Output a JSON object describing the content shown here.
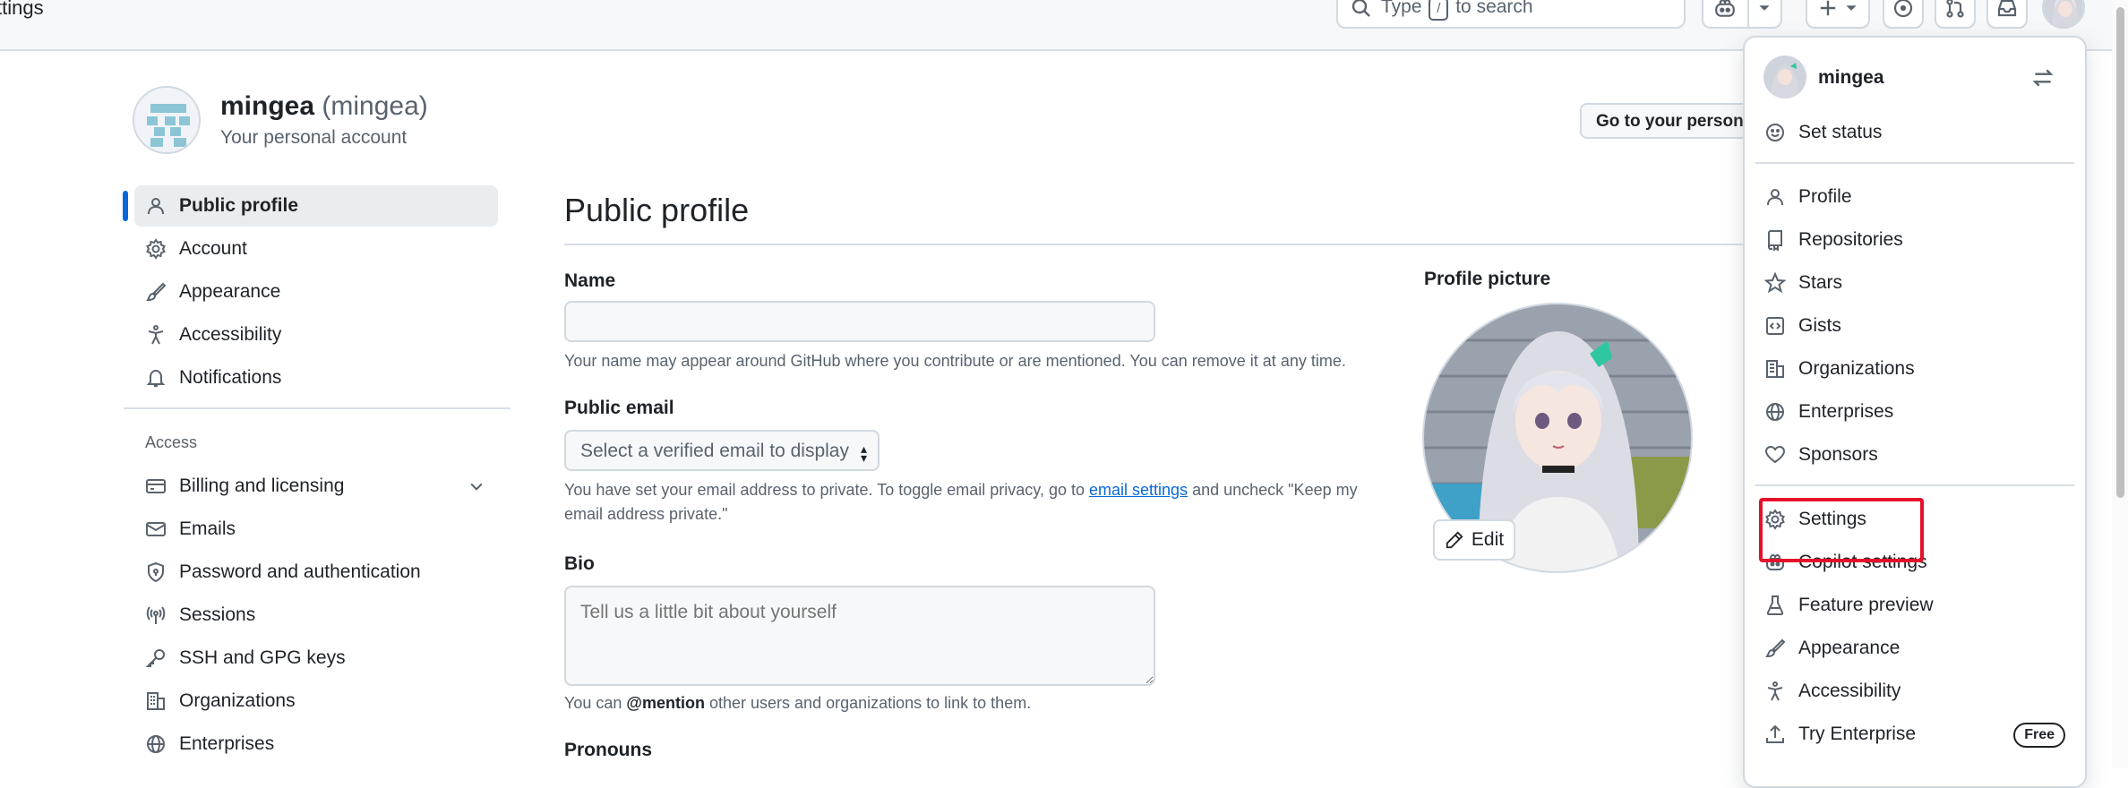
{
  "header": {
    "page_title": "ttings",
    "search": {
      "prefix": "Type",
      "key": "/",
      "suffix": "to search"
    }
  },
  "account": {
    "name": "mingea",
    "login": "(mingea)",
    "subtitle": "Your personal account",
    "goto_button": "Go to your personal profile"
  },
  "nav": {
    "items": [
      {
        "label": "Public profile",
        "icon": "person-icon"
      },
      {
        "label": "Account",
        "icon": "gear-icon"
      },
      {
        "label": "Appearance",
        "icon": "paintbrush-icon"
      },
      {
        "label": "Accessibility",
        "icon": "accessibility-icon"
      },
      {
        "label": "Notifications",
        "icon": "bell-icon"
      }
    ],
    "access_heading": "Access",
    "access_items": [
      {
        "label": "Billing and licensing",
        "icon": "credit-card-icon"
      },
      {
        "label": "Emails",
        "icon": "mail-icon"
      },
      {
        "label": "Password and authentication",
        "icon": "shield-lock-icon"
      },
      {
        "label": "Sessions",
        "icon": "broadcast-icon"
      },
      {
        "label": "SSH and GPG keys",
        "icon": "key-icon"
      },
      {
        "label": "Organizations",
        "icon": "organization-icon"
      },
      {
        "label": "Enterprises",
        "icon": "globe-icon"
      }
    ]
  },
  "main": {
    "title": "Public profile",
    "name_label": "Name",
    "name_value": "",
    "name_hint": "Your name may appear around GitHub where you contribute or are mentioned. You can remove it at any time.",
    "email_label": "Public email",
    "email_select": "Select a verified email to display",
    "email_hint_before": "You have set your email address to private. To toggle email privacy, go to",
    "email_hint_link": "email settings",
    "email_hint_after": "and uncheck \"Keep my",
    "email_hint_line2": "email address private.\"",
    "bio_label": "Bio",
    "bio_placeholder": "Tell us a little bit about yourself",
    "bio_hint_before": "You can",
    "bio_hint_mention": "@mention",
    "bio_hint_after": "other users and organizations to link to them.",
    "pronouns_label": "Pronouns",
    "picture_label": "Profile picture",
    "edit_button": "Edit"
  },
  "menu": {
    "username": "mingea",
    "items": [
      {
        "label": "Set status",
        "icon": "smiley-icon"
      },
      {
        "label": "Profile",
        "icon": "person-icon"
      },
      {
        "label": "Repositories",
        "icon": "repo-icon"
      },
      {
        "label": "Stars",
        "icon": "star-icon"
      },
      {
        "label": "Gists",
        "icon": "code-square-icon"
      },
      {
        "label": "Organizations",
        "icon": "organization-icon"
      },
      {
        "label": "Enterprises",
        "icon": "globe-icon"
      },
      {
        "label": "Sponsors",
        "icon": "heart-icon"
      },
      {
        "label": "Settings",
        "icon": "gear-icon"
      },
      {
        "label": "Copilot settings",
        "icon": "copilot-icon"
      },
      {
        "label": "Feature preview",
        "icon": "beaker-icon"
      },
      {
        "label": "Appearance",
        "icon": "paintbrush-icon"
      },
      {
        "label": "Accessibility",
        "icon": "accessibility-icon"
      },
      {
        "label": "Try Enterprise",
        "icon": "upload-icon"
      }
    ],
    "enterprise_badge": "Free"
  },
  "colors": {
    "accent": "#0969da",
    "highlight": "#e5112b",
    "muted_text": "#59636e",
    "border": "#d1d9e0"
  }
}
